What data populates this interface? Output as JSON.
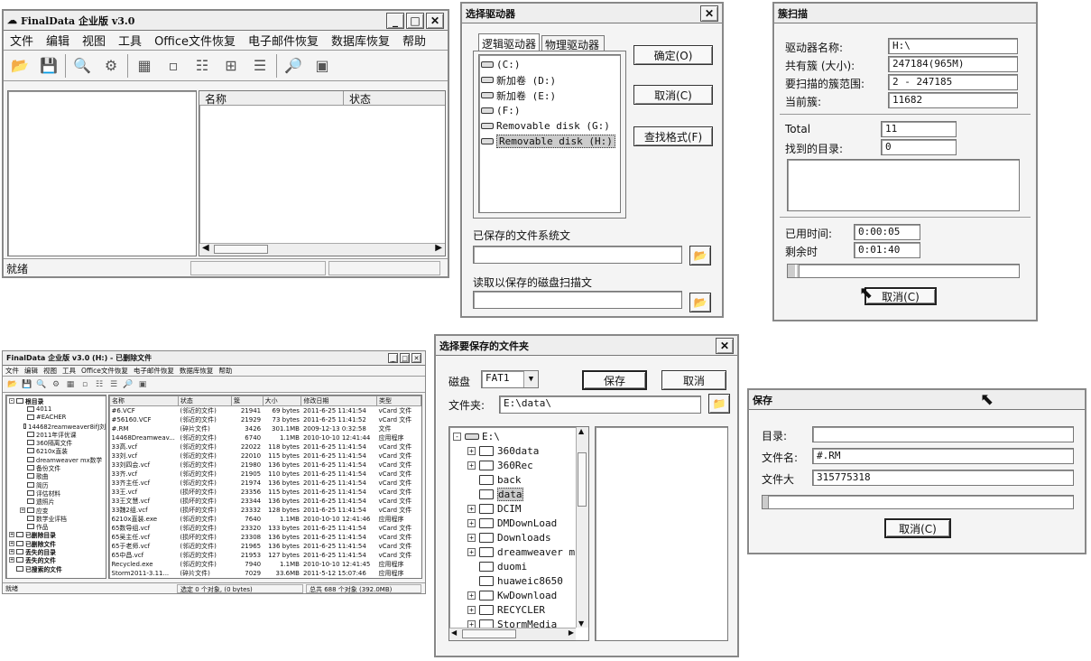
{
  "main_window": {
    "title": "FinalData 企业版 v3.0",
    "menu": [
      "文件",
      "编辑",
      "视图",
      "工具",
      "Office文件恢复",
      "电子邮件恢复",
      "数据库恢复",
      "帮助"
    ],
    "columns": [
      "名称",
      "状态"
    ],
    "status": "就绪"
  },
  "select_drive": {
    "title": "选择驱动器",
    "tabs": [
      "逻辑驱动器",
      "物理驱动器"
    ],
    "drives": [
      "(C:)",
      "新加卷 (D:)",
      "新加卷 (E:)",
      "(F:)",
      "Removable disk (G:)",
      "Removable disk (H:)"
    ],
    "ok": "确定(O)",
    "cancel": "取消(C)",
    "find_format": "查找格式(F)",
    "saved_fs_label": "已保存的文件系统文",
    "read_scan_label": "读取以保存的磁盘扫描文"
  },
  "cluster_scan": {
    "title": "簇扫描",
    "drive_name_label": "驱动器名称:",
    "drive_name": "H:\\",
    "total_clusters_label": "共有簇 (大小):",
    "total_clusters": "247184(965M)",
    "scan_range_label": "要扫描的簇范围:",
    "scan_range": "2 - 247185",
    "current_cluster_label": "当前簇:",
    "current_cluster": "11682",
    "total_label": "Total",
    "total": "11",
    "found_dirs_label": "找到的目录:",
    "found_dirs": "0",
    "elapsed_label": "已用时间:",
    "elapsed": "0:00:05",
    "remaining_label": "剩余时",
    "remaining": "0:01:40",
    "progress": 0.05,
    "cancel": "取消(C)"
  },
  "small_window": {
    "title": "FinalData 企业版 v3.0 (H:) - 已删除文件",
    "menu": [
      "文件",
      "编辑",
      "视图",
      "工具",
      "Office文件恢复",
      "电子邮件恢复",
      "数据库恢复",
      "帮助"
    ],
    "tree": [
      {
        "label": "根目录",
        "bold": true,
        "pm": "-",
        "indent": 0
      },
      {
        "label": "4011",
        "indent": 1
      },
      {
        "label": "#EACHER",
        "indent": 1
      },
      {
        "label": "144682reamweaver8ifJ刘",
        "indent": 1
      },
      {
        "label": "2011年评优课",
        "indent": 1
      },
      {
        "label": "360隔离文件",
        "indent": 1
      },
      {
        "label": "6210x直装",
        "indent": 1
      },
      {
        "label": "dreamweaver mx数学",
        "indent": 1
      },
      {
        "label": "备份文件",
        "indent": 1
      },
      {
        "label": "歌曲",
        "indent": 1
      },
      {
        "label": "简历",
        "indent": 1
      },
      {
        "label": "评估材料",
        "indent": 1
      },
      {
        "label": "遗照片",
        "indent": 1
      },
      {
        "label": "应变",
        "pm": "+",
        "indent": 1
      },
      {
        "label": "数学业评档",
        "indent": 1
      },
      {
        "label": "作品",
        "indent": 1
      },
      {
        "label": "已删除目录",
        "bold": true,
        "pm": "+",
        "indent": 0
      },
      {
        "label": "已删除文件",
        "bold": true,
        "pm": "+",
        "indent": 0
      },
      {
        "label": "丢失的目录",
        "bold": true,
        "pm": "+",
        "indent": 0
      },
      {
        "label": "丢失的文件",
        "bold": true,
        "pm": "+",
        "indent": 0
      },
      {
        "label": "已搜索的文件",
        "bold": true,
        "indent": 0
      }
    ],
    "columns": [
      "名称",
      "状态",
      "簇",
      "大小",
      "修改日期",
      "类型"
    ],
    "rows": [
      [
        "#6.VCF",
        "(邻近的文件)",
        "21941",
        "69 bytes",
        "2011-6-25 11:41:54",
        "vCard 文件"
      ],
      [
        "#56160.VCF",
        "(邻近的文件)",
        "21929",
        "73 bytes",
        "2011-6-25 11:41:52",
        "vCard 文件"
      ],
      [
        "#.RM",
        "(碎片文件)",
        "3426",
        "301.1MB",
        "2009-12-13 0:32:58",
        "文件"
      ],
      [
        "14468Dreamweav...",
        "(邻近的文件)",
        "6740",
        "1.1MB",
        "2010-10-10 12:41:44",
        "应用程序"
      ],
      [
        "33高.vcf",
        "(邻近的文件)",
        "22022",
        "118 bytes",
        "2011-6-25 11:41:54",
        "vCard 文件"
      ],
      [
        "33刘.vcf",
        "(邻近的文件)",
        "22010",
        "115 bytes",
        "2011-6-25 11:41:54",
        "vCard 文件"
      ],
      [
        "33刘四会.vcf",
        "(邻近的文件)",
        "21980",
        "136 bytes",
        "2011-6-25 11:41:54",
        "vCard 文件"
      ],
      [
        "33齐.vcf",
        "(邻近的文件)",
        "21905",
        "110 bytes",
        "2011-6-25 11:41:54",
        "vCard 文件"
      ],
      [
        "33齐主任.vcf",
        "(邻近的文件)",
        "21974",
        "136 bytes",
        "2011-6-25 11:41:54",
        "vCard 文件"
      ],
      [
        "33王.vcf",
        "(损坏的文件)",
        "23356",
        "115 bytes",
        "2011-6-25 11:41:54",
        "vCard 文件"
      ],
      [
        "33王文慧.vcf",
        "(损坏的文件)",
        "23344",
        "136 bytes",
        "2011-6-25 11:41:54",
        "vCard 文件"
      ],
      [
        "33魏2组.vcf",
        "(损坏的文件)",
        "23332",
        "128 bytes",
        "2011-6-25 11:41:54",
        "vCard 文件"
      ],
      [
        "6210x直装.exe",
        "(邻近的文件)",
        "7640",
        "1.1MB",
        "2010-10-10 12:41:46",
        "应用程序"
      ],
      [
        "65数导组.vcf",
        "(邻近的文件)",
        "23320",
        "133 bytes",
        "2011-6-25 11:41:54",
        "vCard 文件"
      ],
      [
        "65吴主任.vcf",
        "(损坏的文件)",
        "23308",
        "136 bytes",
        "2011-6-25 11:41:54",
        "vCard 文件"
      ],
      [
        "65于老师.vcf",
        "(邻近的文件)",
        "21965",
        "136 bytes",
        "2011-6-25 11:41:54",
        "vCard 文件"
      ],
      [
        "65中昌.vcf",
        "(邻近的文件)",
        "21953",
        "127 bytes",
        "2011-6-25 11:41:54",
        "vCard 文件"
      ],
      [
        "Recycled.exe",
        "(邻近的文件)",
        "7940",
        "1.1MB",
        "2010-10-10 12:41:45",
        "应用程序"
      ],
      [
        "Storm2011-3.11...",
        "(碎片文件)",
        "7029",
        "33.6MB",
        "2011-5-12 15:07:46",
        "应用程序"
      ]
    ],
    "status": [
      "就绪",
      "选定 0 个对象, (0 bytes)",
      "总共 688 个对象 (392.0MB)"
    ]
  },
  "save_folder": {
    "title": "选择要保存的文件夹",
    "disk_label": "磁盘",
    "disk": "FAT1",
    "save": "保存",
    "cancel": "取消",
    "folder_label": "文件夹:",
    "folder": "E:\\data\\",
    "root": "E:\\",
    "folders": [
      {
        "name": "360data",
        "pm": "+"
      },
      {
        "name": "360Rec",
        "pm": "+"
      },
      {
        "name": "back",
        "pm": ""
      },
      {
        "name": "data",
        "pm": "",
        "selected": true
      },
      {
        "name": "DCIM",
        "pm": "+"
      },
      {
        "name": "DMDownLoad",
        "pm": "+"
      },
      {
        "name": "Downloads",
        "pm": "+"
      },
      {
        "name": "dreamweaver m:",
        "pm": "+"
      },
      {
        "name": "duomi",
        "pm": ""
      },
      {
        "name": "huaweic8650",
        "pm": ""
      },
      {
        "name": "KwDownload",
        "pm": "+"
      },
      {
        "name": "RECYCLER",
        "pm": "+"
      },
      {
        "name": "StormMedia",
        "pm": "+"
      }
    ]
  },
  "save_progress": {
    "title": "保存",
    "dir_label": "目录:",
    "dir": "",
    "filename_label": "文件名:",
    "filename": "#.RM",
    "filesize_label": "文件大",
    "filesize": "315775318",
    "progress": 0.02,
    "cancel": "取消(C)"
  }
}
